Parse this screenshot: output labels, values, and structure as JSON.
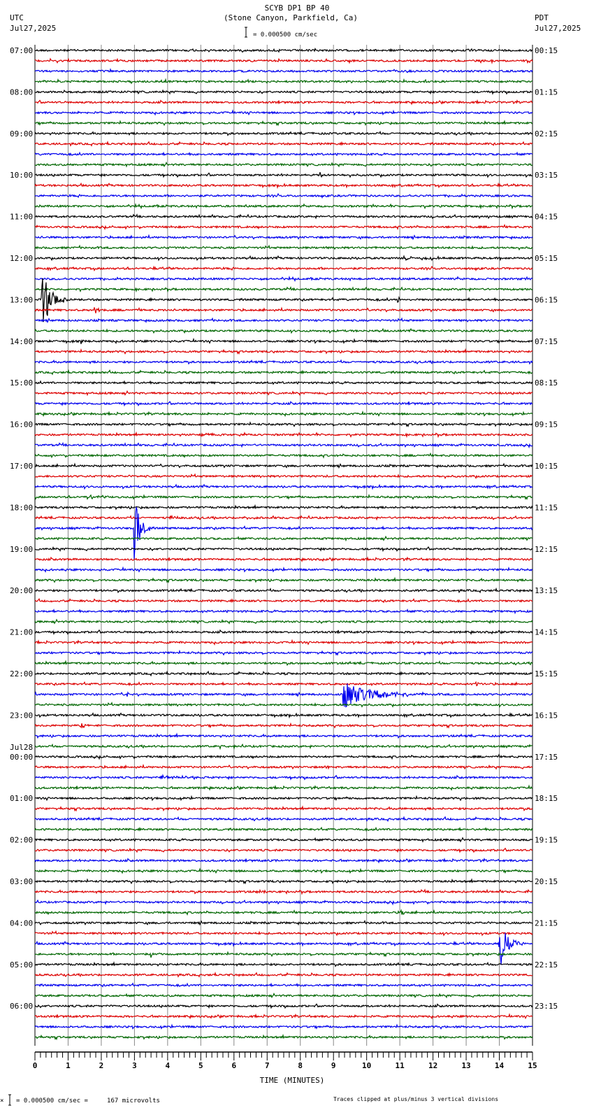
{
  "header": {
    "title": "SCYB DP1 BP 40",
    "subtitle": "(Stone Canyon, Parkfield, Ca)",
    "left_tz": "UTC",
    "left_date": "Jul27,2025",
    "right_tz": "PDT",
    "right_date": "Jul27,2025",
    "scale_text": "= 0.000500 cm/sec"
  },
  "footer": {
    "scale_text": "= 0.000500 cm/sec =     167 microvolts",
    "clip_note": "Traces clipped at plus/minus 3 vertical divisions"
  },
  "chart_data": {
    "type": "line",
    "title": "SCYB DP1 BP 40",
    "xlabel": "TIME (MINUTES)",
    "xlim": [
      0,
      15
    ],
    "x_ticks": [
      "0",
      "1",
      "2",
      "3",
      "4",
      "5",
      "6",
      "7",
      "8",
      "9",
      "10",
      "11",
      "12",
      "13",
      "14",
      "15"
    ],
    "traces_per_hour": 4,
    "trace_colors": [
      "#000000",
      "#dd0000",
      "#0000ee",
      "#006600"
    ],
    "left_labels": [
      "07:00",
      "08:00",
      "09:00",
      "10:00",
      "11:00",
      "12:00",
      "13:00",
      "14:00",
      "15:00",
      "16:00",
      "17:00",
      "18:00",
      "19:00",
      "20:00",
      "21:00",
      "22:00",
      "23:00",
      "00:00",
      "01:00",
      "02:00",
      "03:00",
      "04:00",
      "05:00",
      "06:00"
    ],
    "date_change": {
      "hour_index": 17,
      "label": "Jul28"
    },
    "right_labels": [
      "00:15",
      "01:15",
      "02:15",
      "03:15",
      "04:15",
      "05:15",
      "06:15",
      "07:15",
      "08:15",
      "09:15",
      "10:15",
      "11:15",
      "12:15",
      "13:15",
      "14:15",
      "15:15",
      "16:15",
      "17:15",
      "18:15",
      "19:15",
      "20:15",
      "21:15",
      "22:15",
      "23:15"
    ],
    "clip_divisions": 3,
    "events": [
      {
        "trace": 12,
        "minute": 8.6,
        "amplitude": 0.4,
        "duration": 0.1
      },
      {
        "trace": 20,
        "minute": 11.1,
        "amplitude": 0.2,
        "duration": 0.9
      },
      {
        "trace": 24,
        "minute": 0.2,
        "amplitude": 3.0,
        "duration": 0.8
      },
      {
        "trace": 24,
        "minute": 10.95,
        "amplitude": 0.35,
        "duration": 0.1
      },
      {
        "trace": 25,
        "minute": 1.8,
        "amplitude": 0.45,
        "duration": 0.3
      },
      {
        "trace": 28,
        "minute": 1.4,
        "amplitude": 0.15,
        "duration": 0.6
      },
      {
        "trace": 37,
        "minute": 5.0,
        "amplitude": 0.1,
        "duration": 2.2
      },
      {
        "trace": 43,
        "minute": 1.6,
        "amplitude": 0.15,
        "duration": 0.8
      },
      {
        "trace": 45,
        "minute": 4.1,
        "amplitude": 0.3,
        "duration": 0.4
      },
      {
        "trace": 45,
        "minute": 6.3,
        "amplitude": 0.12,
        "duration": 0.8
      },
      {
        "trace": 46,
        "minute": 3.0,
        "amplitude": 3.0,
        "duration": 0.5
      },
      {
        "trace": 61,
        "minute": 13.3,
        "amplitude": 0.2,
        "duration": 0.3
      },
      {
        "trace": 62,
        "minute": 2.8,
        "amplitude": 0.3,
        "duration": 0.1
      },
      {
        "trace": 62,
        "minute": 9.3,
        "amplitude": 1.3,
        "duration": 2.5
      },
      {
        "trace": 65,
        "minute": 1.4,
        "amplitude": 0.25,
        "duration": 0.5
      },
      {
        "trace": 67,
        "minute": 5.6,
        "amplitude": 0.15,
        "duration": 0.5
      },
      {
        "trace": 69,
        "minute": 8.75,
        "amplitude": 0.5,
        "duration": 0.25
      },
      {
        "trace": 70,
        "minute": 3.8,
        "amplitude": 0.2,
        "duration": 1.8
      },
      {
        "trace": 81,
        "minute": 6.7,
        "amplitude": 0.15,
        "duration": 0.6
      },
      {
        "trace": 83,
        "minute": 11.05,
        "amplitude": 0.55,
        "duration": 0.15
      },
      {
        "trace": 86,
        "minute": 14.0,
        "amplitude": 3.0,
        "duration": 0.6
      },
      {
        "trace": 87,
        "minute": 3.5,
        "amplitude": 0.3,
        "duration": 0.3
      }
    ]
  }
}
